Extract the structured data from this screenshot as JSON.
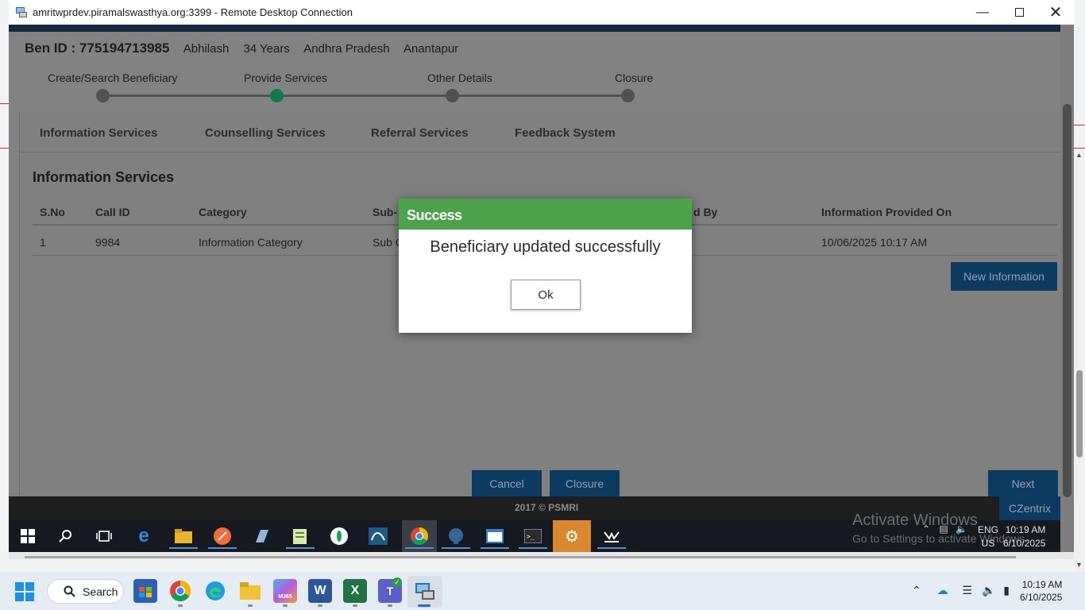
{
  "window": {
    "title": "amritwprdev.piramalswasthya.org:3399 - Remote Desktop Connection",
    "minimize_icon": "minimize-icon",
    "maximize_icon": "maximize-icon",
    "close_icon": "close-icon"
  },
  "beneficiary": {
    "id_label": "Ben ID : 775194713985",
    "name": "Abhilash",
    "age": "34 Years",
    "state": "Andhra Pradesh",
    "district": "Anantapur"
  },
  "stepper": {
    "steps": [
      "Create/Search Beneficiary",
      "Provide Services",
      "Other Details",
      "Closure"
    ],
    "active_index": 1,
    "active_color": "#0f7a4c"
  },
  "tabs": [
    "Information Services",
    "Counselling Services",
    "Referral Services",
    "Feedback System"
  ],
  "section_title": "Information Services",
  "table": {
    "headers": [
      "S.No",
      "Call ID",
      "Category",
      "Sub-",
      "d By",
      "Information Provided On"
    ],
    "rows": [
      [
        "1",
        "9984",
        "Information Category",
        "Sub C",
        "",
        "10/06/2025 10:17 AM"
      ]
    ]
  },
  "buttons": {
    "new_information": "New Information",
    "cancel": "Cancel",
    "closure": "Closure",
    "next": "Next"
  },
  "footer": {
    "copyright": "2017 © PSMRI",
    "czentrix": "CZentrix"
  },
  "modal": {
    "title": "Success",
    "message": "Beneficiary updated successfully",
    "ok_label": "Ok",
    "header_color": "#4ca34c"
  },
  "remote_taskbar": {
    "activate_line1": "Activate Windows",
    "activate_line2": "Go to Settings to activate Windows.",
    "lang_line1": "ENG",
    "lang_line2": "US",
    "time": "10:19 AM",
    "date": "6/10/2025"
  },
  "host_taskbar": {
    "search_label": "Search",
    "time": "10:19 AM",
    "date": "6/10/2025"
  }
}
